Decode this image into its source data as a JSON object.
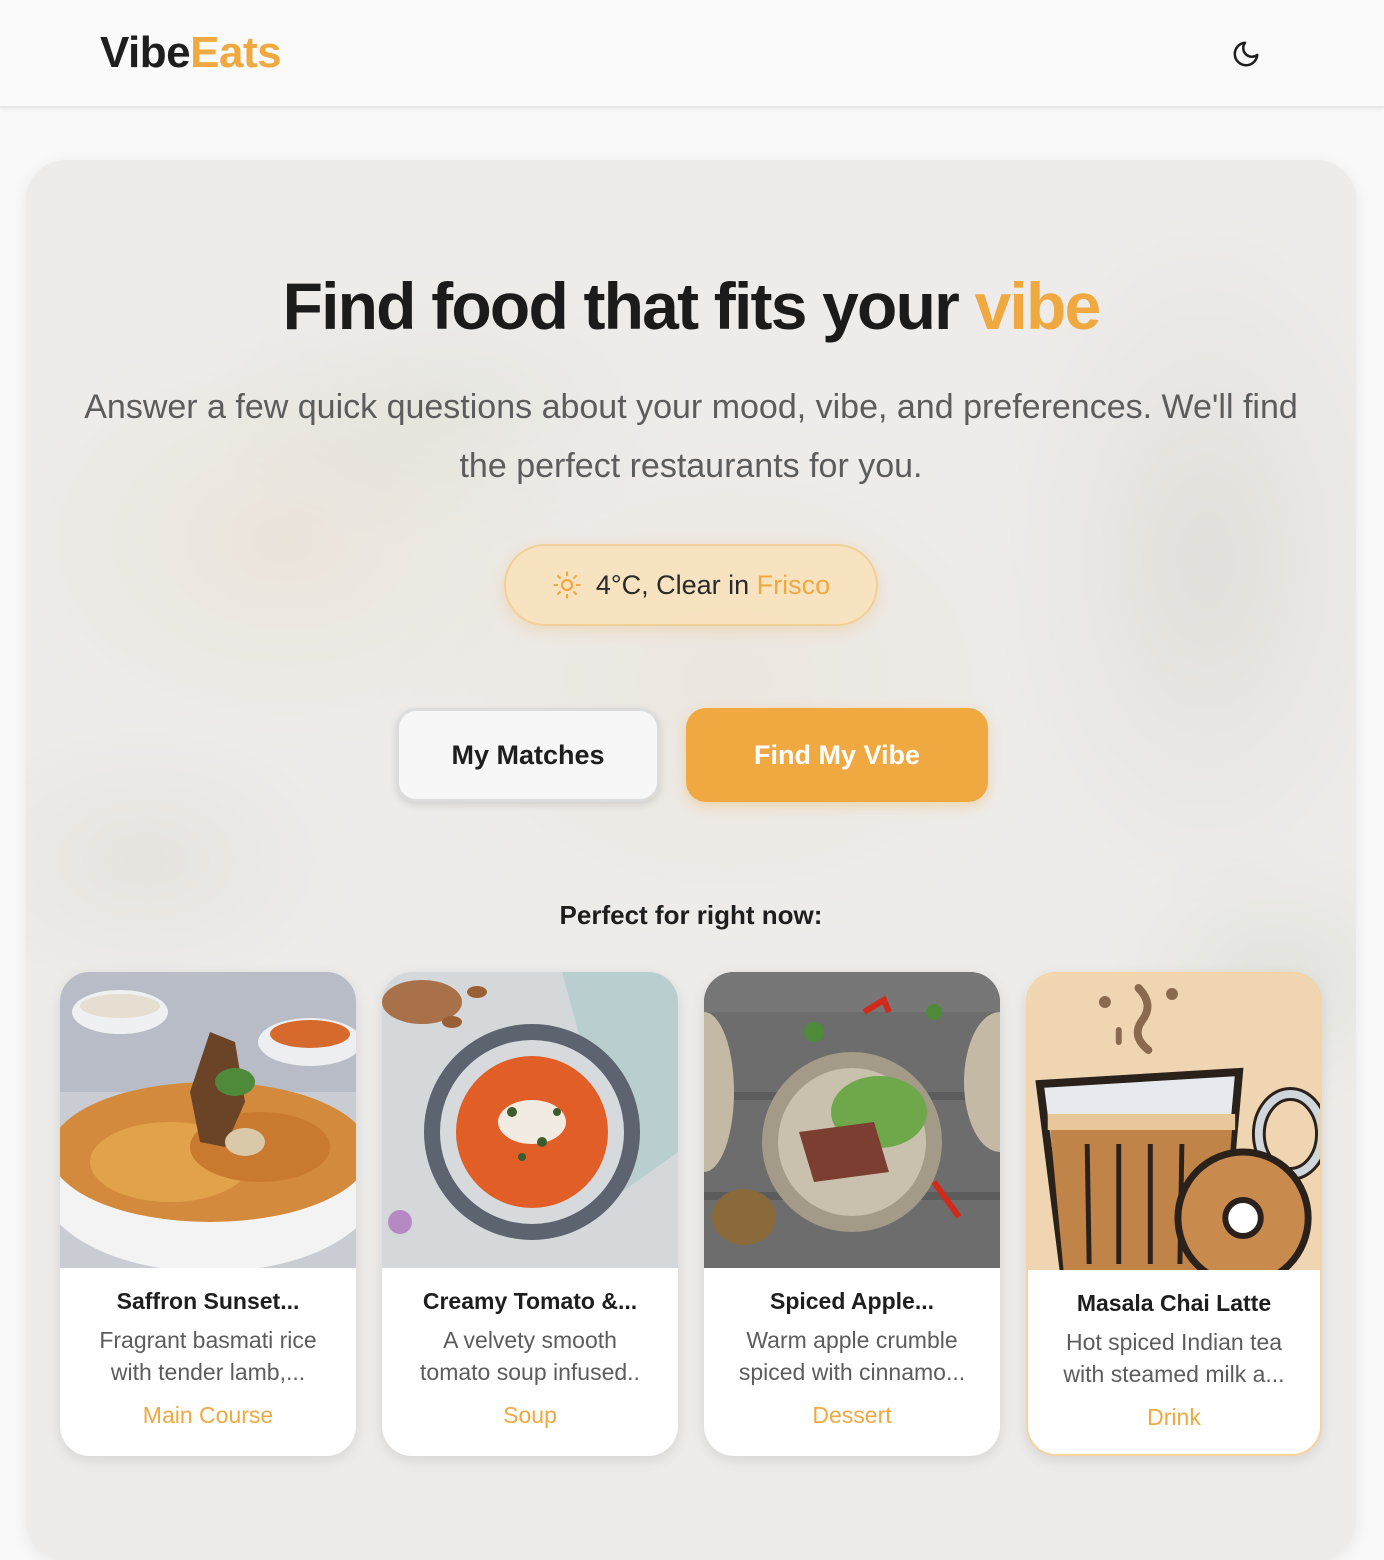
{
  "header": {
    "logo_part1": "Vibe",
    "logo_part2": "Eats",
    "theme_toggle_icon": "moon-icon"
  },
  "hero": {
    "headline_main": "Find food that fits your ",
    "headline_accent": "vibe",
    "subtitle": "Answer a few quick questions about your mood, vibe, and preferences. We'll find the perfect restaurants for you.",
    "weather": {
      "icon": "sun-icon",
      "text": "4°C, Clear in ",
      "city": "Frisco"
    },
    "buttons": {
      "my_matches": "My Matches",
      "find_my_vibe": "Find My Vibe"
    },
    "section_label": "Perfect for right now:"
  },
  "cards": [
    {
      "title": "Saffron Sunset...",
      "desc_line1": "Fragrant basmati rice",
      "desc_line2": "with tender lamb,...",
      "category": "Main Course"
    },
    {
      "title": "Creamy Tomato &...",
      "desc_line1": "A velvety smooth",
      "desc_line2": "tomato soup infused..",
      "category": "Soup"
    },
    {
      "title": "Spiced Apple...",
      "desc_line1": "Warm apple crumble",
      "desc_line2": "spiced with cinnamo...",
      "category": "Dessert"
    },
    {
      "title": "Masala Chai Latte",
      "desc_line1": "Hot spiced Indian tea",
      "desc_line2": "with steamed milk a...",
      "category": "Drink"
    }
  ],
  "colors": {
    "accent": "#f0a840",
    "text_dark": "#1e1e1e",
    "text_muted": "#5c5c5c",
    "pill_bg": "#f8e2be"
  }
}
